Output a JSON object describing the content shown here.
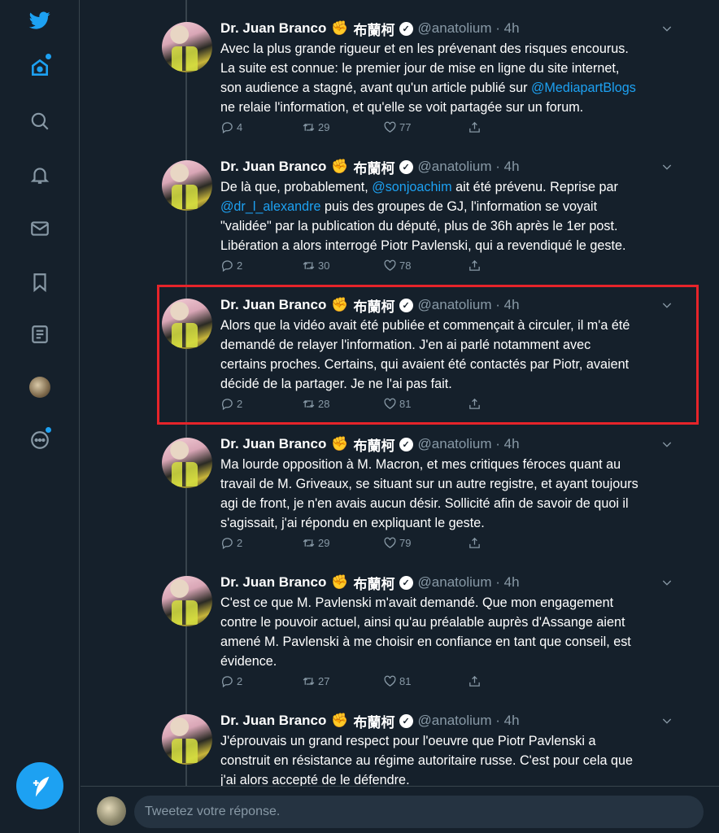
{
  "nav": {
    "items": [
      {
        "name": "twitter-logo-icon",
        "icon": "bird"
      },
      {
        "name": "home-icon",
        "icon": "home"
      },
      {
        "name": "search-icon",
        "icon": "search"
      },
      {
        "name": "notifications-icon",
        "icon": "bell"
      },
      {
        "name": "messages-icon",
        "icon": "envelope"
      },
      {
        "name": "bookmarks-icon",
        "icon": "bookmark"
      },
      {
        "name": "lists-icon",
        "icon": "list"
      },
      {
        "name": "profile-avatar",
        "icon": "avatar"
      },
      {
        "name": "more-icon",
        "icon": "more-circle"
      }
    ],
    "compose_icon": "feather-plus",
    "accent": "#1da1f2"
  },
  "tweets": [
    {
      "name": "Dr. Juan Branco",
      "emoji": "✊",
      "cjk": "布蘭柯",
      "handle": "@anatolium · 4h",
      "text_parts": [
        {
          "t": "Avec la plus grande rigueur et en les prévenant des risques encourus.\nLa suite est connue: le premier jour de mise en ligne du site internet,\nson audience a stagné, avant qu'un article publié sur "
        },
        {
          "t": "@MediapartBlogs",
          "mention": true
        },
        {
          "t": "\nne relaie l'information, et qu'elle se voit partagée sur un forum."
        }
      ],
      "replies": "4",
      "retweets": "29",
      "likes": "77"
    },
    {
      "name": "Dr. Juan Branco",
      "emoji": "✊",
      "cjk": "布蘭柯",
      "handle": "@anatolium · 4h",
      "text_parts": [
        {
          "t": "De là que, probablement, "
        },
        {
          "t": "@sonjoachim",
          "mention": true
        },
        {
          "t": " ait été prévenu. Reprise par\n"
        },
        {
          "t": "@dr_l_alexandre",
          "mention": true
        },
        {
          "t": " puis des groupes de GJ, l'information se voyait\n\"validée\" par la publication du député, plus de 36h après le 1er post.\nLibération a alors interrogé Piotr Pavlenski, qui a revendiqué le geste."
        }
      ],
      "replies": "2",
      "retweets": "30",
      "likes": "78"
    },
    {
      "name": "Dr. Juan Branco",
      "emoji": "✊",
      "cjk": "布蘭柯",
      "handle": "@anatolium · 4h",
      "text_parts": [
        {
          "t": "Alors que la vidéo avait été publiée et commençait à circuler, il m'a été\ndemandé de relayer l'information. J'en ai parlé notamment avec\ncertains proches. Certains, qui avaient été contactés par Piotr, avaient\ndécidé de la partager. Je ne l'ai pas fait."
        }
      ],
      "replies": "2",
      "retweets": "28",
      "likes": "81"
    },
    {
      "name": "Dr. Juan Branco",
      "emoji": "✊",
      "cjk": "布蘭柯",
      "handle": "@anatolium · 4h",
      "text_parts": [
        {
          "t": "Ma lourde opposition à M. Macron, et mes critiques féroces quant au\ntravail de M. Griveaux, se situant sur un autre registre, et ayant toujours\nagi de front, je n'en avais aucun désir. Sollicité afin de savoir de quoi il\ns'agissait, j'ai répondu en expliquant le geste."
        }
      ],
      "replies": "2",
      "retweets": "29",
      "likes": "79"
    },
    {
      "name": "Dr. Juan Branco",
      "emoji": "✊",
      "cjk": "布蘭柯",
      "handle": "@anatolium · 4h",
      "text_parts": [
        {
          "t": "C'est ce que M. Pavlenski m'avait demandé. Que mon engagement\ncontre le pouvoir actuel, ainsi qu'au préalable auprès d'Assange aient\namené M. Pavlenski à me choisir en confiance en tant que conseil, est\névidence."
        }
      ],
      "replies": "2",
      "retweets": "27",
      "likes": "81"
    },
    {
      "name": "Dr. Juan Branco",
      "emoji": "✊",
      "cjk": "布蘭柯",
      "handle": "@anatolium · 4h",
      "text_parts": [
        {
          "t": "J'éprouvais un grand respect pour l'oeuvre que Piotr Pavlenski a\nconstruit en résistance au régime autoritaire russe. C'est pour cela que\nj'ai alors accepté de le défendre."
        }
      ],
      "replies": "",
      "retweets": "",
      "likes": ""
    }
  ],
  "reply": {
    "placeholder": "Tweetez votre réponse."
  },
  "colors": {
    "background": "#15202b",
    "secondary_text": "#8899a6",
    "highlight_box": "#e6242a"
  }
}
